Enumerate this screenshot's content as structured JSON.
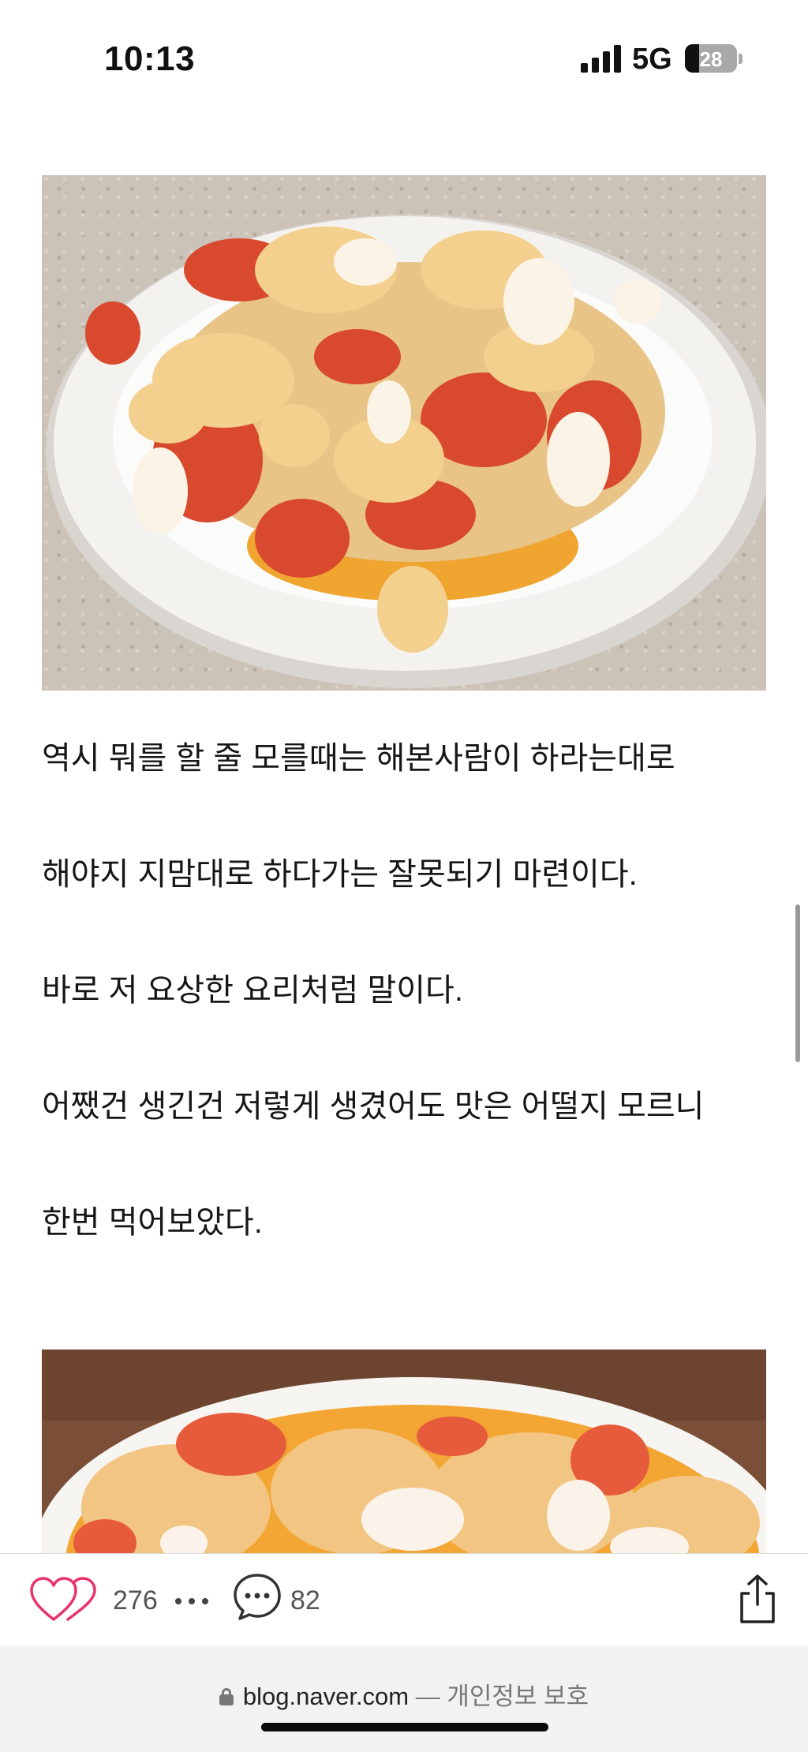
{
  "status_bar": {
    "time": "10:13",
    "network": "5G",
    "battery": "28",
    "battery_level": 0.28
  },
  "article": {
    "photo_1_alt": "photo-scrambled-egg-tomato",
    "paragraphs": [
      "역시 뭐를 할 줄 모를때는 해본사람이 하라는대로",
      "해야지 지맘대로 하다가는 잘못되기 마련이다.",
      "바로 저 요상한 요리처럼 말이다.",
      "어쨌건 생긴건 저렇게 생겼어도 맛은 어떨지 모르니",
      "한번 먹어보았다."
    ]
  },
  "actions": {
    "like_count": "276",
    "comment_count": "82",
    "heart_icon": "heart-icon",
    "more_icon": "more-icon",
    "comment_icon": "comment-icon",
    "share_icon": "share-icon",
    "accent": "#e8336a"
  },
  "browser": {
    "domain": "blog.naver.com",
    "separator": " — ",
    "privacy": "개인정보 보호"
  }
}
